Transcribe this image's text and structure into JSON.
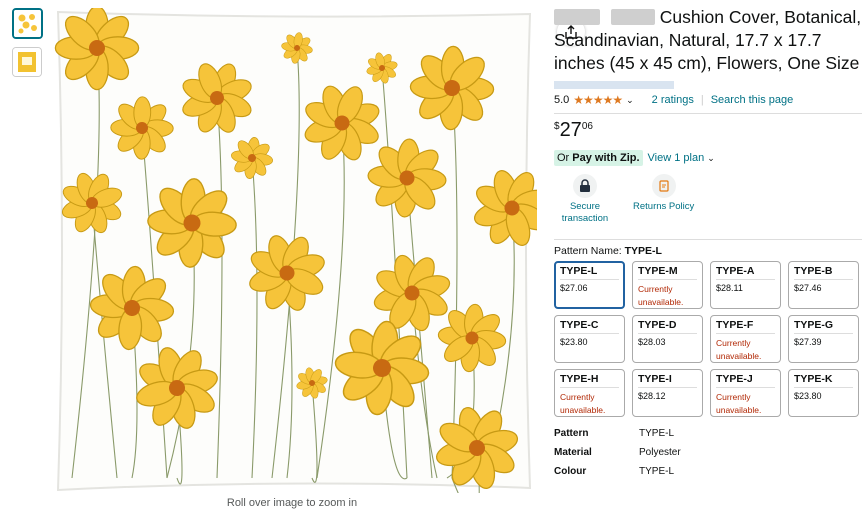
{
  "product": {
    "title": "Cushion Cover, Botanical, Scandinavian, Natural, 17.7 x 17.7 inches (45 x 45 cm), Flowers, One Size",
    "rating_value": "5.0",
    "ratings_count": "2 ratings",
    "search_link": "Search this page",
    "price_symbol": "$",
    "price_whole": "27",
    "price_cents": "06"
  },
  "payment": {
    "prefix": "Or",
    "zip_label": "Pay with Zip.",
    "plan_link": "View 1 plan"
  },
  "badges": [
    {
      "label": "Secure transaction",
      "icon": "lock-icon"
    },
    {
      "label": "Returns Policy",
      "icon": "return-icon"
    }
  ],
  "gallery": {
    "zoom_hint": "Roll over image to zoom in"
  },
  "pattern": {
    "label": "Pattern Name:",
    "selected": "TYPE-L",
    "options": [
      {
        "name": "TYPE-L",
        "price": "$27.06",
        "unavailable": ""
      },
      {
        "name": "TYPE-M",
        "price": "",
        "unavailable": "Currently unavailable."
      },
      {
        "name": "TYPE-A",
        "price": "$28.11",
        "unavailable": ""
      },
      {
        "name": "TYPE-B",
        "price": "$27.46",
        "unavailable": ""
      },
      {
        "name": "TYPE-C",
        "price": "$23.80",
        "unavailable": ""
      },
      {
        "name": "TYPE-D",
        "price": "$28.03",
        "unavailable": ""
      },
      {
        "name": "TYPE-F",
        "price": "",
        "unavailable": "Currently unavailable."
      },
      {
        "name": "TYPE-G",
        "price": "$27.39",
        "unavailable": ""
      },
      {
        "name": "TYPE-H",
        "price": "",
        "unavailable": "Currently unavailable."
      },
      {
        "name": "TYPE-I",
        "price": "$28.12",
        "unavailable": ""
      },
      {
        "name": "TYPE-J",
        "price": "",
        "unavailable": "Currently unavailable."
      },
      {
        "name": "TYPE-K",
        "price": "$23.80",
        "unavailable": ""
      }
    ]
  },
  "specs": [
    {
      "key": "Pattern",
      "value": "TYPE-L"
    },
    {
      "key": "Material",
      "value": "Polyester"
    },
    {
      "key": "Colour",
      "value": "TYPE-L"
    }
  ],
  "colors": {
    "link": "#007185",
    "star": "#de7921",
    "unavailable": "#b12704",
    "selected_border": "#2162a1",
    "zip_bg": "#d6f3e6",
    "flower": "#f6c43a"
  }
}
